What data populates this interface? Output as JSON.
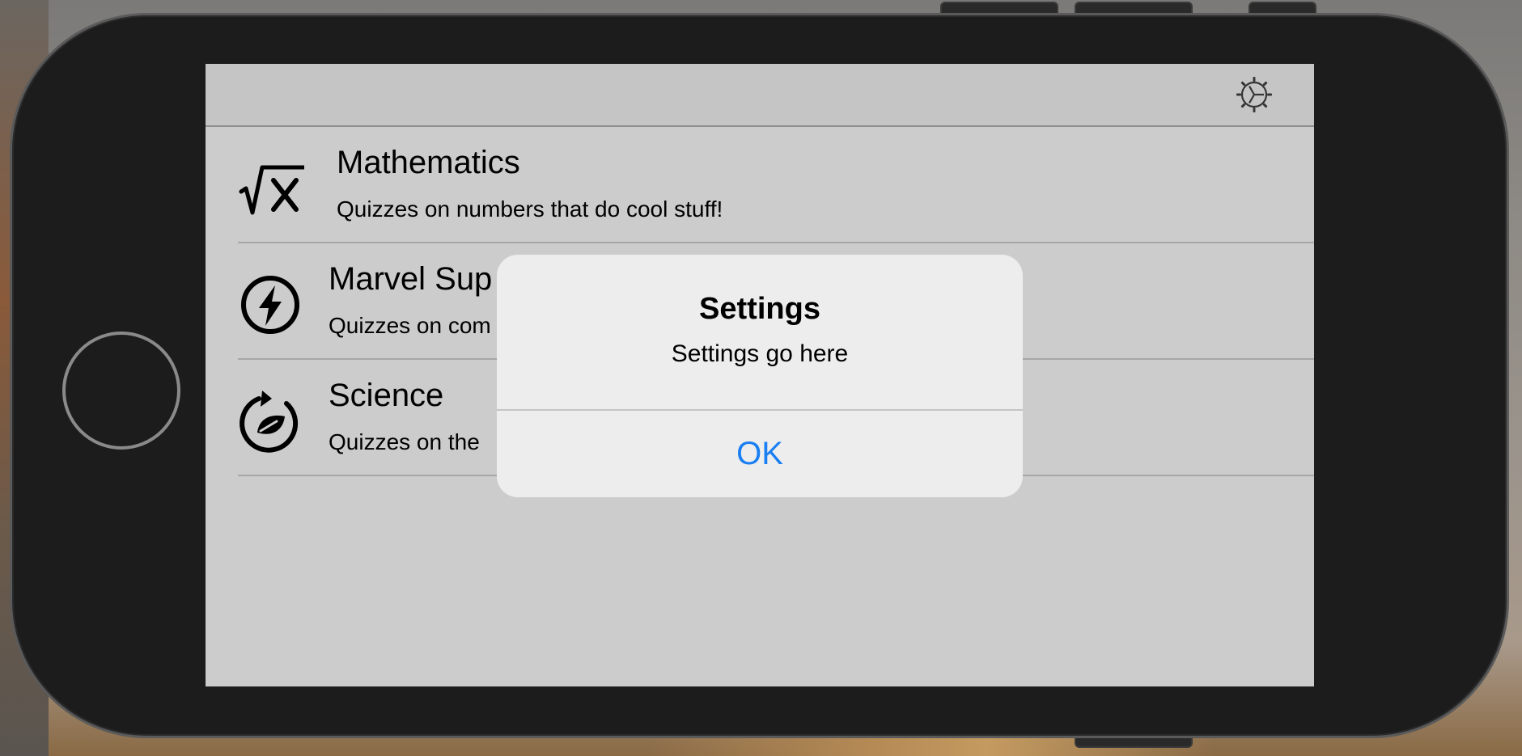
{
  "navbar": {
    "settings_icon": "gear-icon"
  },
  "quizzes": [
    {
      "icon": "square-root-icon",
      "title": "Mathematics",
      "subtitle": "Quizzes on numbers that do cool stuff!"
    },
    {
      "icon": "lightning-bolt-icon",
      "title": "Marvel Sup",
      "subtitle": "Quizzes on com"
    },
    {
      "icon": "science-leaf-cycle-icon",
      "title": "Science",
      "subtitle": "Quizzes on the"
    }
  ],
  "alert": {
    "title": "Settings",
    "message": "Settings go here",
    "ok_label": "OK"
  },
  "colors": {
    "accent": "#1a7ff2",
    "alert_background": "#ededed",
    "device_body": "#1c1c1c"
  }
}
